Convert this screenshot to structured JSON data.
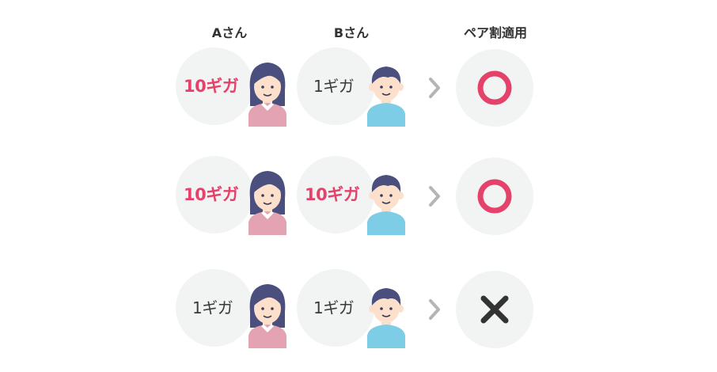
{
  "headers": {
    "a": "Aさん",
    "b": "Bさん",
    "result": "ペア割適用"
  },
  "rows": [
    {
      "a_amount": "10ギガ",
      "a_hi": true,
      "b_amount": "1ギガ",
      "b_hi": false,
      "result": "circle-icon"
    },
    {
      "a_amount": "10ギガ",
      "a_hi": true,
      "b_amount": "10ギガ",
      "b_hi": true,
      "result": "circle-icon"
    },
    {
      "a_amount": "1ギガ",
      "a_hi": false,
      "b_amount": "1ギガ",
      "b_hi": false,
      "result": "cross-icon"
    }
  ],
  "colors": {
    "accent": "#e5426b",
    "bubble": "#f2f3f3",
    "text": "#333333",
    "chevron": "#b5b5b5",
    "hair": "#4a4f7e",
    "skin": "#fde0cc",
    "shirt_a": "#e3a3b3",
    "shirt_b": "#7dcde6"
  }
}
